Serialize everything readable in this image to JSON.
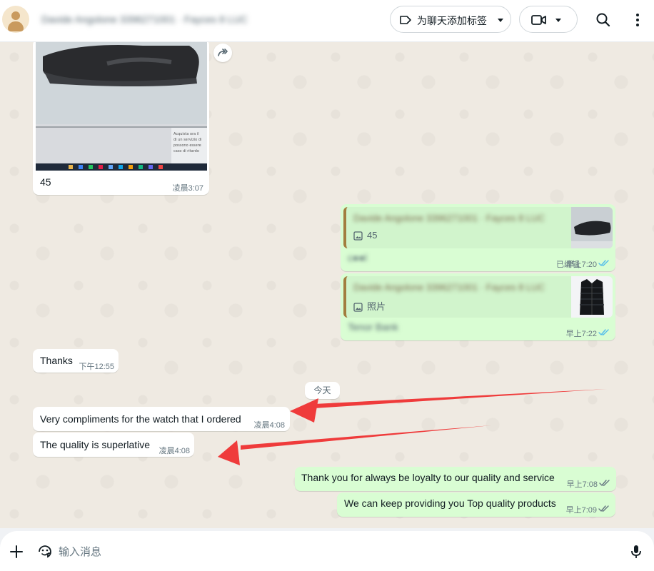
{
  "header": {
    "contact_name": "Davide Angolone 3396271001 · Fayces 8 LUC",
    "label_button": "为聊天添加标签"
  },
  "messages": {
    "image_caption": "45",
    "image_time": "凌晨3:07",
    "screen_text": "Acquista ora il\ndi un servizio di\npossono essere\ncaso di ritardo",
    "reply1": {
      "quoted_name": "Davide Angolone 3396271001 · Fayces 8 LUC",
      "quoted_sub": "45",
      "text": "c●●l",
      "edited": "已编辑",
      "time": "早上7:20"
    },
    "reply2": {
      "quoted_name": "Davide Angolone 3396271001 · Fayces 8 LUC",
      "quoted_sub": "照片",
      "text": "Tenor Bank",
      "time": "早上7:22"
    },
    "thanks": {
      "text": "Thanks",
      "time": "下午12:55"
    },
    "day_separator": "今天",
    "compliment": {
      "text": "Very compliments for the watch that I ordered",
      "time": "凌晨4:08"
    },
    "quality": {
      "text": "The quality is superlative",
      "time": "凌晨4:08"
    },
    "out1": {
      "text": "Thank you for always be loyalty to our quality and service",
      "time": "早上7:08"
    },
    "out2": {
      "text": "We can keep providing you Top quality products",
      "time": "早上7:09"
    }
  },
  "composer": {
    "placeholder": "输入消息"
  },
  "colors": {
    "outgoing_bubble": "#d9fdd3",
    "incoming_bubble": "#ffffff",
    "chat_background": "#efeae2",
    "read_ticks": "#53bdeb",
    "annotation_arrow": "#ef3b3b"
  }
}
